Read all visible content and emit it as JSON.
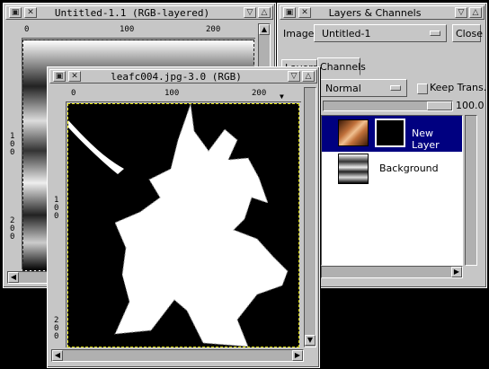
{
  "windows": {
    "untitled": {
      "title": "Untitled-1.1 (RGB-layered)",
      "hruler_ticks": [
        "0",
        "100",
        "200"
      ],
      "vruler_ticks": [
        "1\n0\n0",
        "2\n0\n0"
      ]
    },
    "leaf": {
      "title": "leafc004.jpg-3.0 (RGB)",
      "hruler_ticks": [
        "0",
        "100",
        "200"
      ],
      "vruler_ticks": [
        "1\n0\n0",
        "2\n0\n0"
      ]
    },
    "layers": {
      "title": "Layers & Channels",
      "image_label": "Image:",
      "image_value": "Untitled-1",
      "close_label": "Close",
      "tabs": [
        "Layers",
        "Channels"
      ],
      "mode_value": "Normal",
      "keep_trans_label": "Keep Trans.",
      "opacity_value": "100.0",
      "layers": [
        {
          "name": "New Layer",
          "selected": true
        },
        {
          "name": "Background",
          "selected": false
        }
      ]
    }
  },
  "colors": {
    "selection": "#000080",
    "window_bg": "#c6c6c6"
  }
}
